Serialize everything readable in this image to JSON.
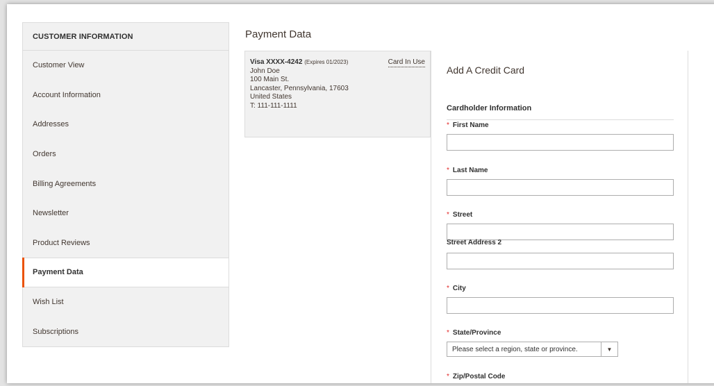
{
  "sidebar": {
    "header": "CUSTOMER INFORMATION",
    "items": [
      {
        "label": "Customer View"
      },
      {
        "label": "Account Information"
      },
      {
        "label": "Addresses"
      },
      {
        "label": "Orders"
      },
      {
        "label": "Billing Agreements"
      },
      {
        "label": "Newsletter"
      },
      {
        "label": "Product Reviews"
      },
      {
        "label": "Payment Data",
        "active": true
      },
      {
        "label": "Wish List"
      },
      {
        "label": "Subscriptions"
      }
    ]
  },
  "main": {
    "title": "Payment Data",
    "card": {
      "name": "Visa XXXX-4242",
      "expires": "(Expires 01/2023)",
      "status_link": "Card In Use",
      "holder": "John Doe",
      "street": "100 Main St.",
      "city_line": "Lancaster, Pennsylvania, 17603",
      "country": "United States",
      "phone": "T: 111-111-1111"
    },
    "form": {
      "title": "Add A Credit Card",
      "section": "Cardholder Information",
      "required_mark": "*",
      "fields": {
        "first_name": "First Name",
        "last_name": "Last Name",
        "street": "Street",
        "street2": "Street Address 2",
        "city": "City",
        "state": "State/Province",
        "zip": "Zip/Postal Code"
      },
      "state_select": {
        "value": "Please select a region, state or province.",
        "arrow": "▼"
      }
    }
  },
  "colors": {
    "accent": "#eb5202",
    "required": "#e22626",
    "sidebar_bg": "#f1f1f1"
  }
}
